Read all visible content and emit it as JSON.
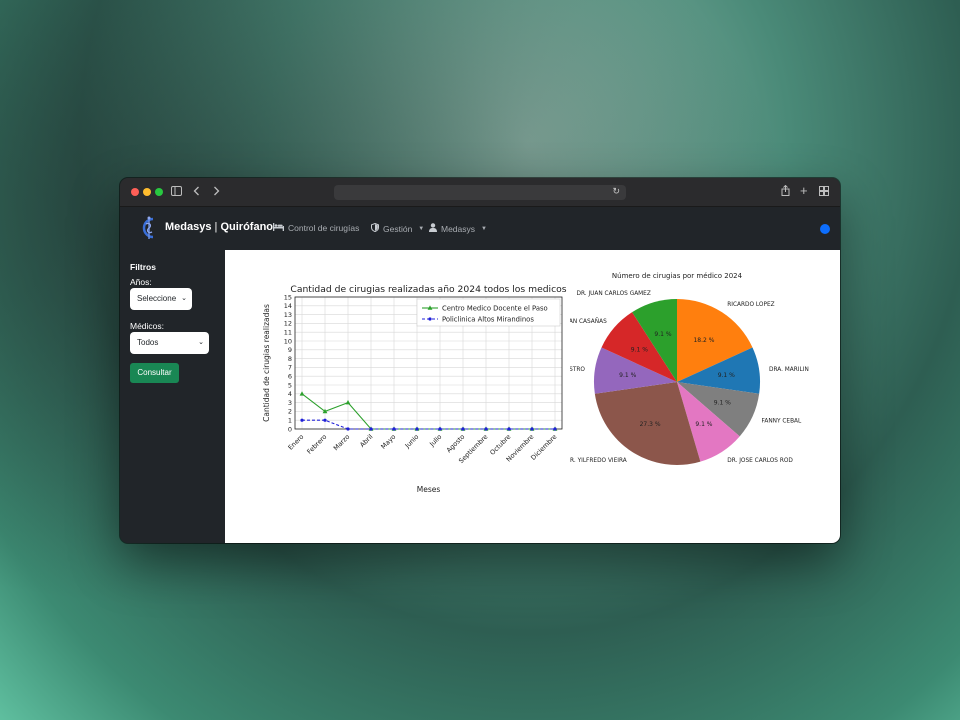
{
  "browser": {
    "url": ""
  },
  "navbar": {
    "brand": "Medasys",
    "brand_sep": " | ",
    "brand_section": "Quirófano",
    "items": [
      {
        "label": "Control de cirugías",
        "icon": "bed-icon"
      },
      {
        "label": "Gestión",
        "icon": "shield-icon"
      },
      {
        "label": "Medasys",
        "icon": "user-icon"
      }
    ]
  },
  "sidebar": {
    "title": "Filtros",
    "years_label": "Años:",
    "years_value": "Seleccione",
    "doctors_label": "Médicos:",
    "doctors_value": "Todos",
    "submit_label": "Consultar"
  },
  "chart_data": [
    {
      "type": "line",
      "title": "Cantidad de cirugias realizadas año 2024 todos los medicos",
      "xlabel": "Meses",
      "ylabel": "Cantidad de cirugias realizadas",
      "categories": [
        "Enero",
        "Febrero",
        "Marzo",
        "Abril",
        "Mayo",
        "Junio",
        "Julio",
        "Agosto",
        "Septiembre",
        "Octubre",
        "Noviembre",
        "Diciembre"
      ],
      "ylim": [
        0,
        15
      ],
      "yticks": [
        0,
        1,
        2,
        3,
        4,
        5,
        6,
        7,
        8,
        9,
        10,
        11,
        12,
        13,
        14,
        15
      ],
      "grid": true,
      "legend": "top-right",
      "series": [
        {
          "name": "Centro Medico Docente el Paso",
          "color": "#2ca02c",
          "marker": "triangle",
          "style": "solid",
          "values": [
            4,
            2,
            3,
            0,
            0,
            0,
            0,
            0,
            0,
            0,
            0,
            0
          ]
        },
        {
          "name": "Policlinica Altos Mirandinos",
          "color": "#1f1fd8",
          "marker": "dot",
          "style": "dashed",
          "values": [
            1,
            1,
            0,
            0,
            0,
            0,
            0,
            0,
            0,
            0,
            0,
            0
          ]
        }
      ]
    },
    {
      "type": "pie",
      "title": "Número de cirugias por médico 2024",
      "slices": [
        {
          "label": "RICARDO LOPEZ",
          "value": 18.2,
          "pct_label": "18.2 %",
          "color": "#ff7f0e"
        },
        {
          "label": "DRA. MARILIN",
          "value": 9.1,
          "pct_label": "9.1 %",
          "color": "#1f77b4"
        },
        {
          "label": "FANNY CEBAL",
          "value": 9.1,
          "pct_label": "9.1 %",
          "color": "#7f7f7f"
        },
        {
          "label": "DR. JOSE CARLOS ROD",
          "value": 9.1,
          "pct_label": "9.1 %",
          "color": "#e377c2"
        },
        {
          "label": "DR. YILFREDO VIEIRA",
          "value": 27.3,
          "pct_label": "27.3 %",
          "color": "#8c564b"
        },
        {
          "label": "HENRY CASTRO",
          "value": 9.1,
          "pct_label": "9.1 %",
          "color": "#9467bd"
        },
        {
          "label": "REIDAN CASAÑAS",
          "value": 9.1,
          "pct_label": "9.1 %",
          "color": "#d62728"
        },
        {
          "label": "DR. JUAN CARLOS GAMEZ",
          "value": 9.1,
          "pct_label": "9.1 %",
          "color": "#2ca02c"
        }
      ]
    }
  ]
}
